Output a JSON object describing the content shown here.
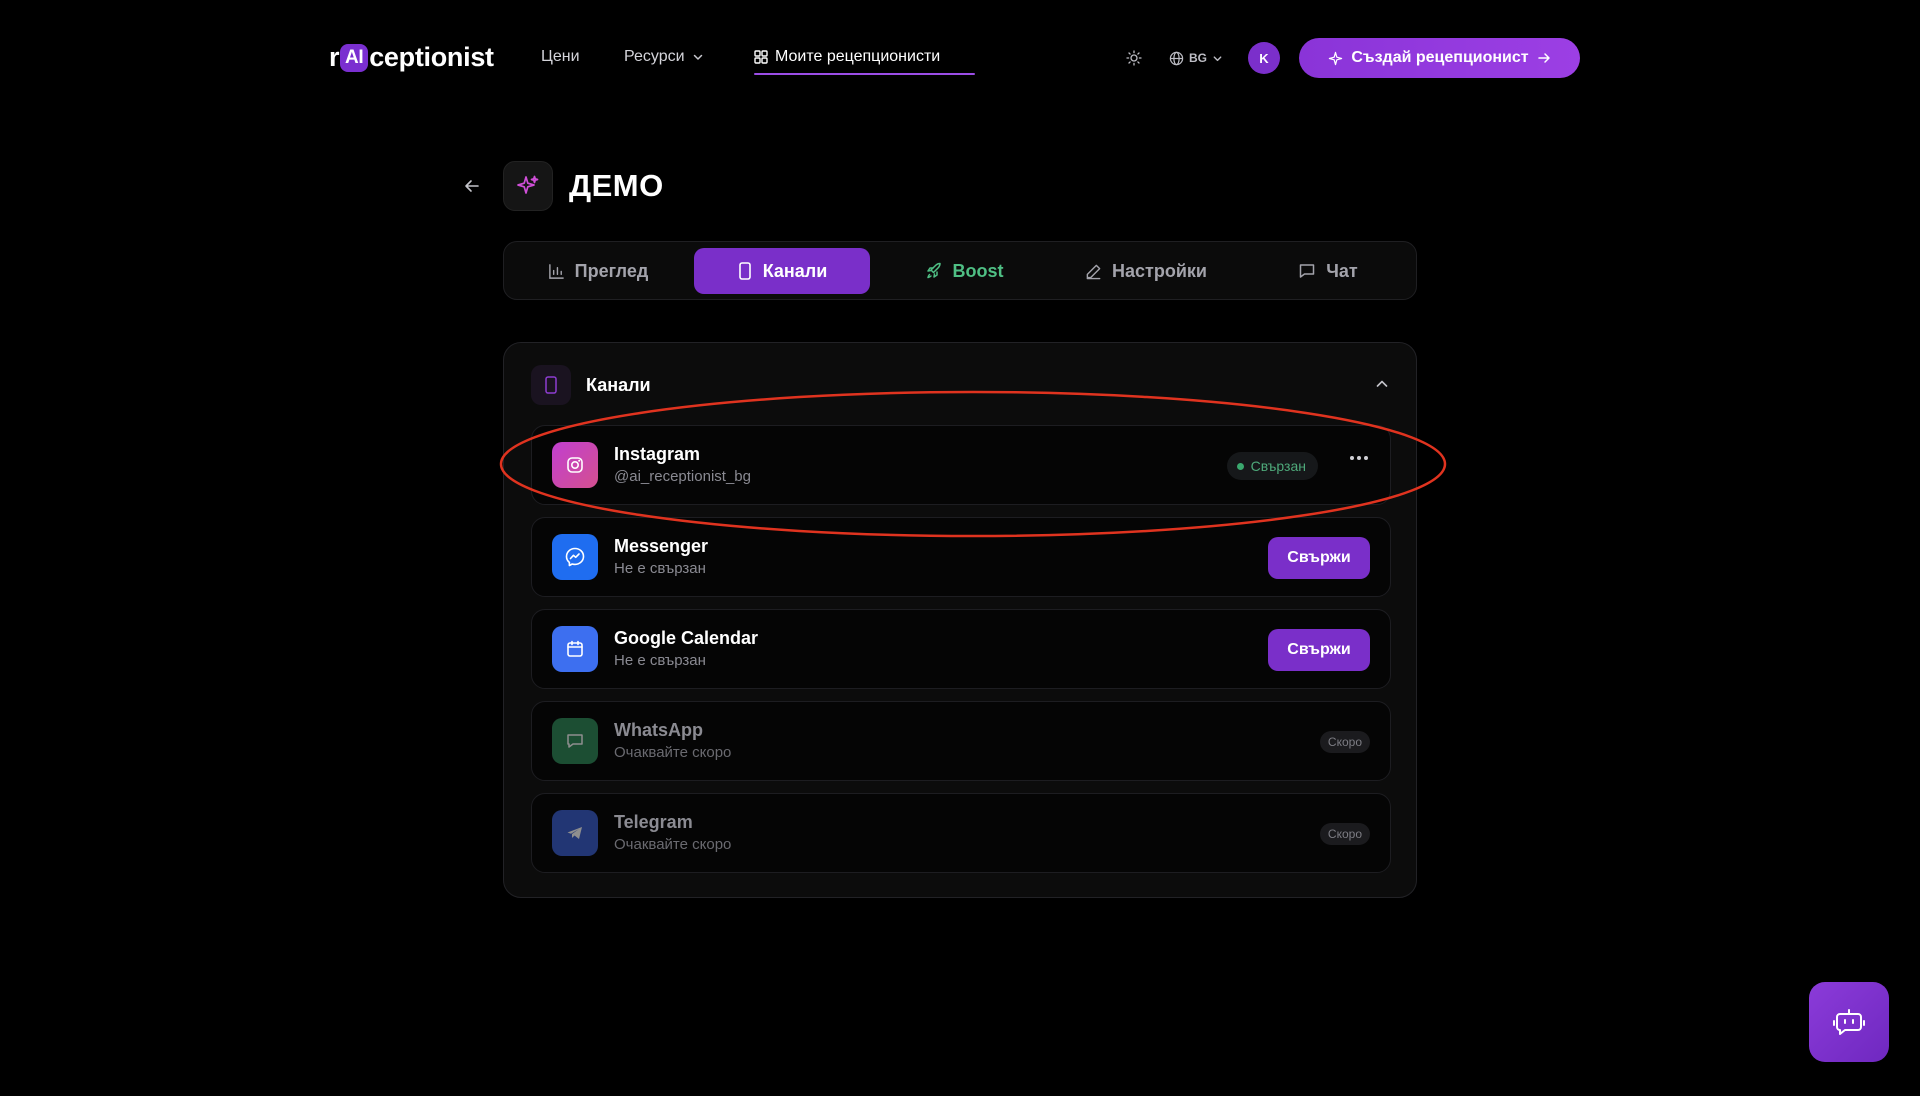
{
  "header": {
    "logo": {
      "pre": "r",
      "ai": "AI",
      "post": "ceptionist"
    },
    "nav": {
      "pricing": "Цени",
      "resources": "Ресурси",
      "my_receptionists": "Моите рецепционисти"
    },
    "language": "BG",
    "avatar_initial": "K",
    "create_button": "Създай рецепционист"
  },
  "page": {
    "title": "ДЕМО"
  },
  "tabs": [
    {
      "label": "Преглед"
    },
    {
      "label": "Канали"
    },
    {
      "label": "Boost"
    },
    {
      "label": "Настройки"
    },
    {
      "label": "Чат"
    }
  ],
  "channels": {
    "title": "Канали",
    "items": [
      {
        "name": "Instagram",
        "sub": "@ai_receptionist_bg",
        "status": "Свързан"
      },
      {
        "name": "Messenger",
        "sub": "Не е свързан",
        "action": "Свържи"
      },
      {
        "name": "Google Calendar",
        "sub": "Не е свързан",
        "action": "Свържи"
      },
      {
        "name": "WhatsApp",
        "sub": "Очаквайте скоро",
        "badge": "Скоро"
      },
      {
        "name": "Telegram",
        "sub": "Очаквайте скоро",
        "badge": "Скоро"
      }
    ]
  },
  "colors": {
    "accent": "#7a2fc9",
    "connected": "#3aa86e",
    "highlight_annotation": "#e0331f"
  }
}
